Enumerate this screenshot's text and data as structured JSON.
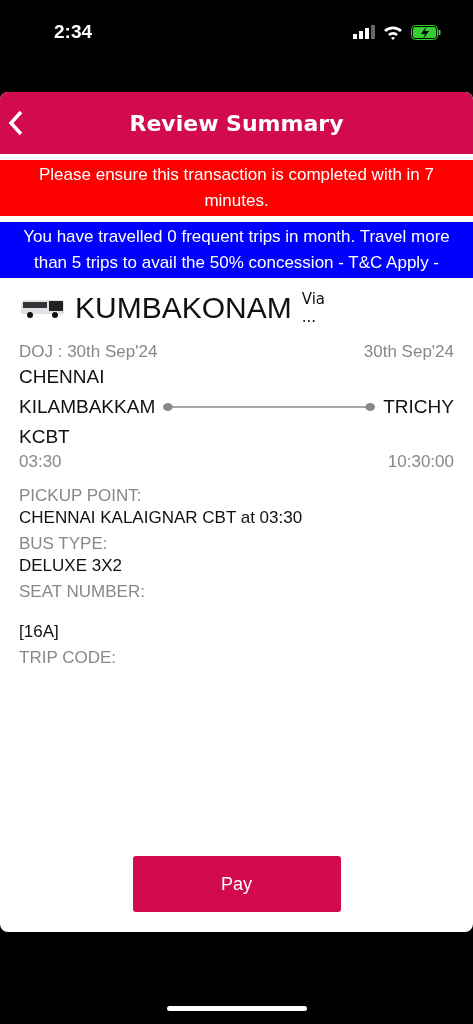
{
  "status_bar": {
    "time": "2:34"
  },
  "header": {
    "title": "Review Summary"
  },
  "alerts": [
    {
      "text": "Please ensure this transaction is completed with in 7 minutes.",
      "color": "#ff0000"
    },
    {
      "text": "You have travelled 0 frequent trips in month. Travel more than 5 trips to avail the 50% concession - T&C Apply -",
      "color": "#0000ff"
    }
  ],
  "route": {
    "destination": "KUMBAKONAM",
    "via": "Via",
    "via_more": "..."
  },
  "journey": {
    "doj": "DOJ : 30th Sep'24",
    "arrival_date": "30th Sep'24",
    "from_lines": [
      "CHENNAI",
      "KILAMBAKKAM",
      "KCBT"
    ],
    "to": "TRICHY",
    "departure_time": "03:30",
    "arrival_time": "10:30:00"
  },
  "details": [
    {
      "label": "PICKUP POINT:",
      "value": "CHENNAI KALAIGNAR CBT at 03:30"
    },
    {
      "label": "BUS TYPE:",
      "value": "DELUXE 3X2"
    },
    {
      "label": "SEAT NUMBER:",
      "value": "[16A]"
    },
    {
      "label": "TRIP CODE:"
    }
  ],
  "pay_button": "Pay"
}
